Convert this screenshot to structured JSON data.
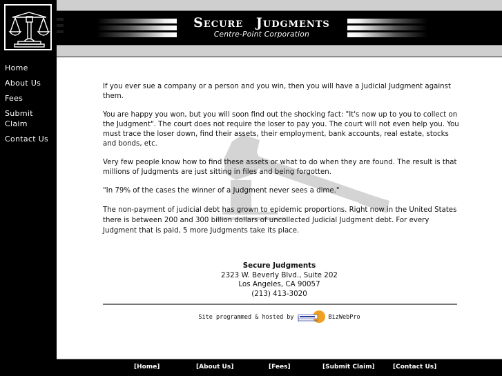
{
  "header": {
    "title_first": "Secure",
    "title_second": "Judgments",
    "subtitle": "Centre-Point Corporation",
    "logo_icon": "scales-of-justice-icon"
  },
  "sidebar": {
    "items": [
      {
        "label": "Home"
      },
      {
        "label": "About Us"
      },
      {
        "label": "Fees"
      },
      {
        "label": "Submit Claim"
      },
      {
        "label": "Contact Us"
      }
    ]
  },
  "main": {
    "paragraphs": [
      "If you ever sue a company or a person and you win, then you will have a Judicial Judgment against them.",
      "You are happy you won, but you will soon find out the shocking fact: \"It's now up to you to collect on the Judgment\". The court does not require the loser to pay you. The court will not even help you. You must trace the loser down, find their assets, their employment, bank accounts, real estate, stocks and bonds, etc.",
      "Very few people know how to find these assets or what to do when they are found. The result is that millions of Judgments are just sitting in files and being forgotten.",
      "\"In 79% of the cases the winner of a Judgment never sees a dime.\"",
      "The non-payment of judicial debt has grown to epidemic proportions. Right now in the United States there is between 200 and 300 billion dollars of uncollected Judicial Judgment debt. For every Judgment that is paid, 5 more Judgments take its place."
    ],
    "watermark_icon": "gavel-icon"
  },
  "address": {
    "name": "Secure Judgments",
    "street": "2323 W. Beverly Blvd., Suite 202",
    "city": "Los Angeles, CA 90057",
    "phone": "(213) 413-3020"
  },
  "credit": {
    "text": "Site programmed & hosted by",
    "logo_text": "BizWebPro.com",
    "name": "BizWebPro"
  },
  "footer": {
    "links": [
      {
        "label": "[Home]"
      },
      {
        "label": "[About Us]"
      },
      {
        "label": "[Fees]"
      },
      {
        "label": "[Submit Claim]"
      },
      {
        "label": "[Contact Us]"
      }
    ]
  },
  "colors": {
    "background": "#000000",
    "header_gray": "#cfcfcf",
    "content_bg": "#ffffff",
    "watermark": "#d4d4d4",
    "credit_orange": "#f0a020",
    "credit_blue": "#2a3a9a"
  }
}
